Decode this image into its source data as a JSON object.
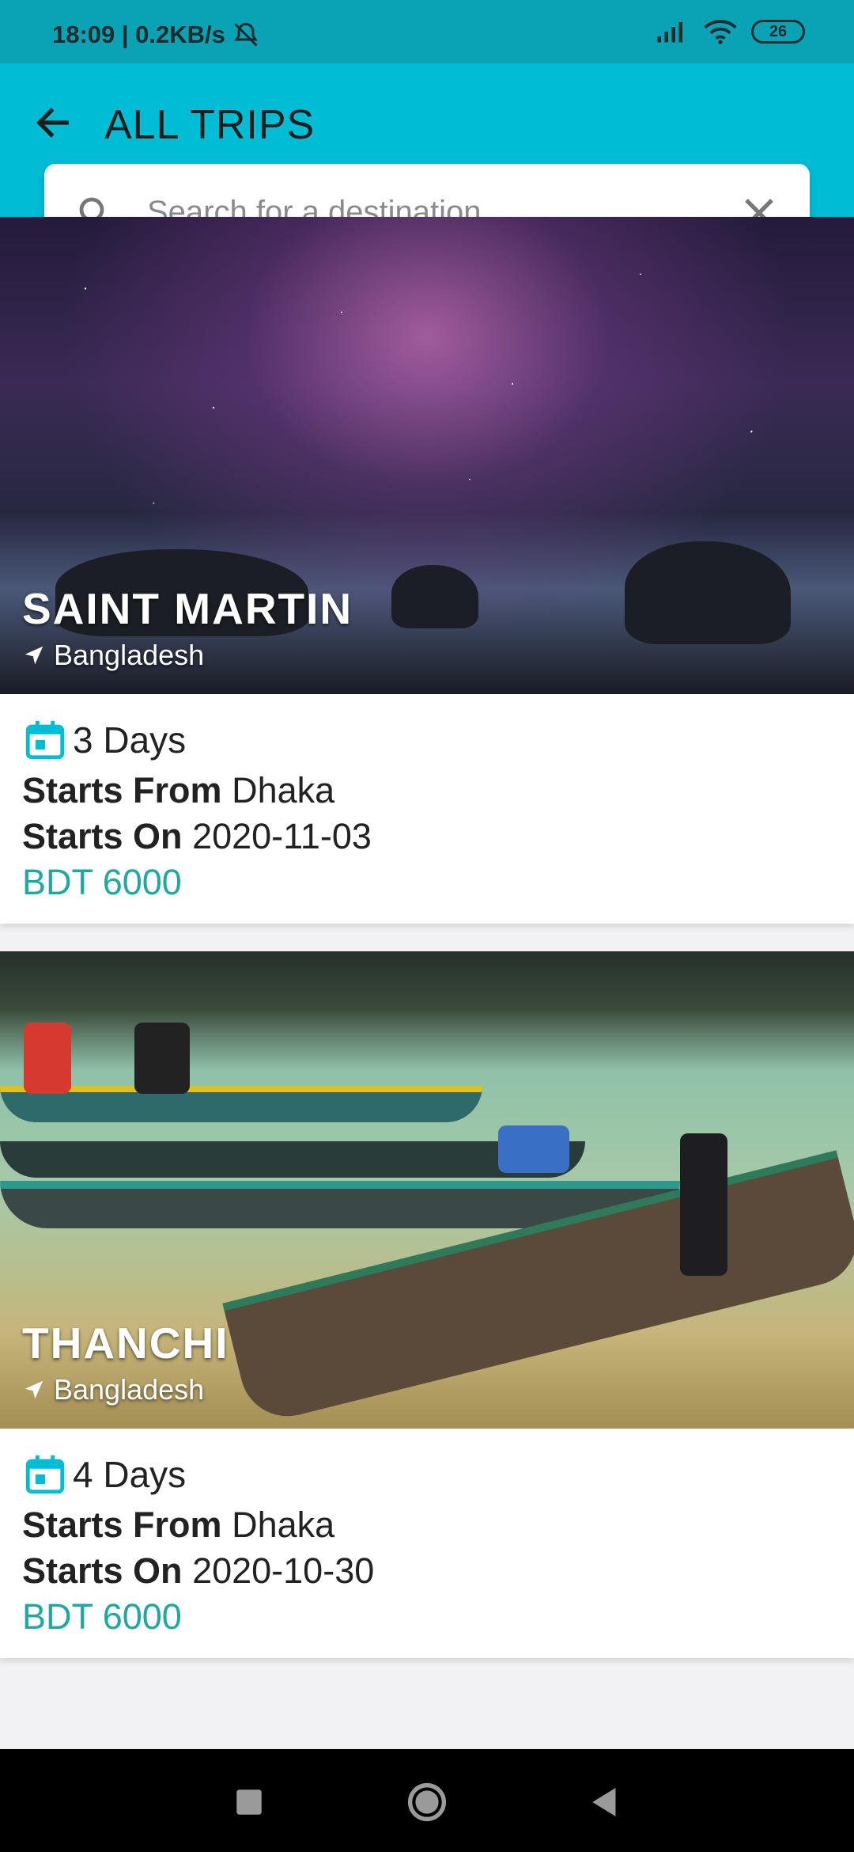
{
  "status_bar": {
    "time_speed": "18:09 | 0.2KB/s",
    "battery": "26"
  },
  "header": {
    "title": "ALL TRIPS"
  },
  "search": {
    "placeholder": "Search for a destination...",
    "value": ""
  },
  "trips": [
    {
      "name": "SAINT MARTIN",
      "country": "Bangladesh",
      "days": "3 Days",
      "starts_from_label": "Starts From",
      "starts_from": "Dhaka",
      "starts_on_label": "Starts On",
      "starts_on": "2020-11-03",
      "price": "BDT 6000"
    },
    {
      "name": "THANCHI",
      "country": "Bangladesh",
      "days": "4 Days",
      "starts_from_label": "Starts From",
      "starts_from": "Dhaka",
      "starts_on_label": "Starts On",
      "starts_on": "2020-10-30",
      "price": "BDT 6000"
    }
  ],
  "icons": {
    "back": "arrow-left-icon",
    "search": "search-icon",
    "clear": "close-icon",
    "location": "navigation-arrow-icon",
    "calendar": "calendar-icon"
  },
  "colors": {
    "app_bar": "#00bcd4",
    "status_bar": "#0aa3b6",
    "price": "#1fa89f",
    "calendar_icon": "#00bcd4"
  }
}
